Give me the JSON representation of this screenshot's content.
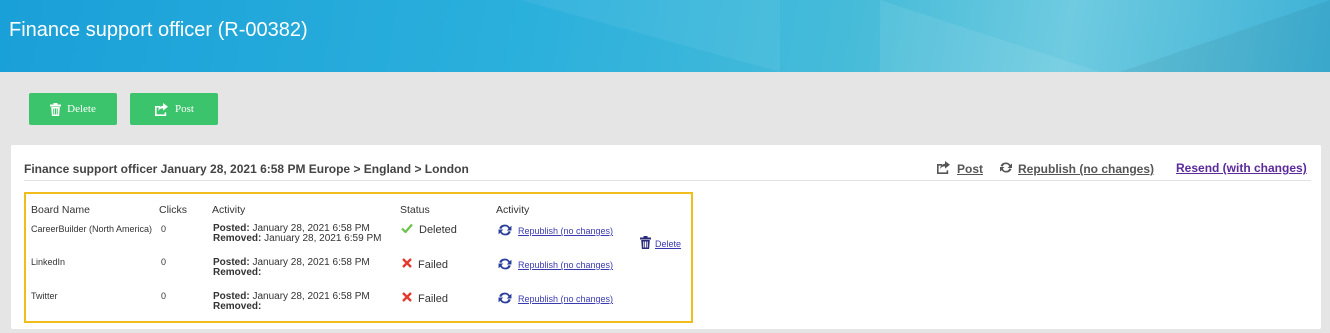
{
  "header": {
    "title": "Finance support officer (R-00382)"
  },
  "toolbar": {
    "delete_label": "Delete",
    "post_label": "Post"
  },
  "panel": {
    "title": "Finance support officer January 28, 2021 6:58 PM Europe > England > London",
    "actions": {
      "post": "Post",
      "republish": "Republish (no changes)",
      "resend": "Resend (with changes)"
    }
  },
  "table": {
    "headers": {
      "board": "Board Name",
      "clicks": "Clicks",
      "activity": "Activity",
      "status": "Status",
      "activity2": "Activity"
    },
    "rows": [
      {
        "board": "CareerBuilder (North America)",
        "clicks": "0",
        "posted_label": "Posted:",
        "posted": " January 28, 2021 6:58 PM",
        "removed_label": "Removed:",
        "removed": " January 28, 2021 6:59 PM",
        "status": "Deleted",
        "republish": "Republish (no changes)"
      },
      {
        "board": "LinkedIn",
        "clicks": "0",
        "posted_label": "Posted:",
        "posted": " January 28, 2021 6:58 PM",
        "removed_label": "Removed:",
        "removed": "",
        "status": "Failed",
        "republish": "Republish (no changes)"
      },
      {
        "board": "Twitter",
        "clicks": "0",
        "posted_label": "Posted:",
        "posted": " January 28, 2021 6:58 PM",
        "removed_label": "Removed:",
        "removed": "",
        "status": "Failed",
        "republish": "Republish (no changes)"
      }
    ],
    "delete_label": "Delete"
  },
  "colors": {
    "header_gradient_start": "#1aa0d8",
    "button_green": "#3cc46c",
    "highlight_border": "#f1bd1b",
    "resend_link": "#5b2a9a",
    "status_deleted": "#6cc24a",
    "status_failed": "#e23b2e"
  },
  "icons": {
    "delete": "trash-icon",
    "post": "share-icon",
    "republish": "refresh-icon",
    "deleted_status": "check-icon",
    "failed_status": "x-icon"
  }
}
